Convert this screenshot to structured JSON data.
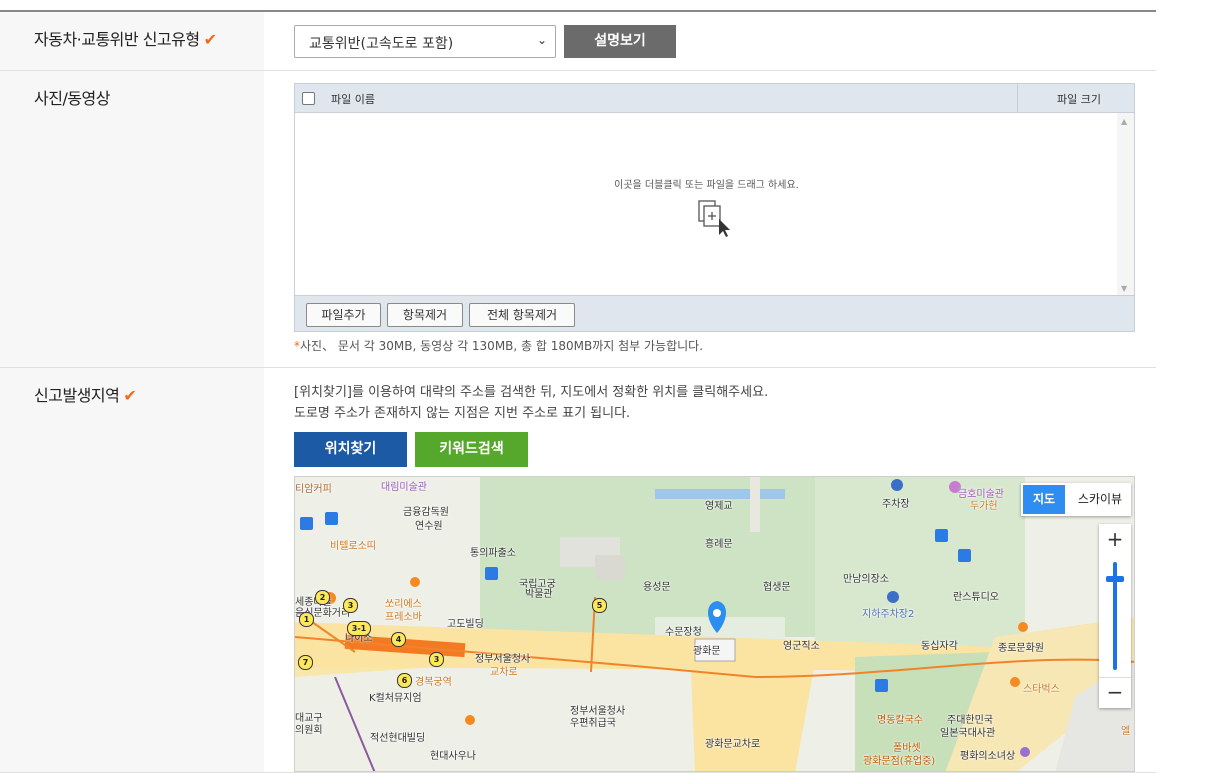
{
  "rows": {
    "type": {
      "label": "자동차·교통위반 신고유형",
      "required_mark": "✔",
      "select_value": "교통위반(고속도로 포함)",
      "explain_button": "설명보기"
    },
    "media": {
      "label": "사진/동영상",
      "col_filename": "파일 이름",
      "col_filesize": "파일 크기",
      "drop_hint": "이곳을 더블클릭 또는 파일을 드래그 하세요.",
      "btn_add": "파일추가",
      "btn_remove": "항목제거",
      "btn_remove_all": "전체 항목제거",
      "note_star": "*",
      "note": "사진、 문서 각 30MB, 동영상 각 130MB, 총 합 180MB까지 첨부 가능합니다."
    },
    "location": {
      "label": "신고발생지역",
      "required_mark": "✔",
      "desc1": "[위치찾기]를 이용하여 대략의 주소를 검색한 뒤, 지도에서 정확한 위치를 클릭해주세요.",
      "desc2": "도로명 주소가 존재하지 않는 지점은 지번 주소로 표기 됩니다.",
      "btn_find": "위치찾기",
      "btn_keyword": "키워드검색"
    }
  },
  "map": {
    "tab_map": "지도",
    "tab_sky": "스카이뷰",
    "zoom_in": "+",
    "zoom_out": "−",
    "labels": [
      "티암커피",
      "대림미술관",
      "금융감독원",
      "연수원",
      "비텔로소띠",
      "통의파출소",
      "국립고궁",
      "박물관",
      "영제교",
      "흥례문",
      "용성문",
      "협생문",
      "주차장",
      "금호미술관",
      "두가헌",
      "만남의장소",
      "지하주차장2",
      "란스튜디오",
      "쏘리에스",
      "프레소바",
      "고도빌딩",
      "수문장청",
      "광화문",
      "영군직소",
      "동십자각",
      "종로문화원",
      "세종마을",
      "음식문화거리",
      "나이소",
      "정부서울청사",
      "교차로",
      "경복궁역",
      "K컬처뮤지엄",
      "스타벅스",
      "정부서울청사",
      "우편취급국",
      "명동칼국수",
      "주대한민국",
      "일본국대사관",
      "대교구",
      "의원회",
      "적선현대빌딩",
      "현대사우나",
      "광화문교차로",
      "폴바셋",
      "광화문점(휴업중)",
      "평화의소녀상",
      "엘"
    ],
    "markers": [
      "2",
      "3",
      "1",
      "3-1",
      "4",
      "7",
      "6",
      "3",
      "5"
    ]
  }
}
